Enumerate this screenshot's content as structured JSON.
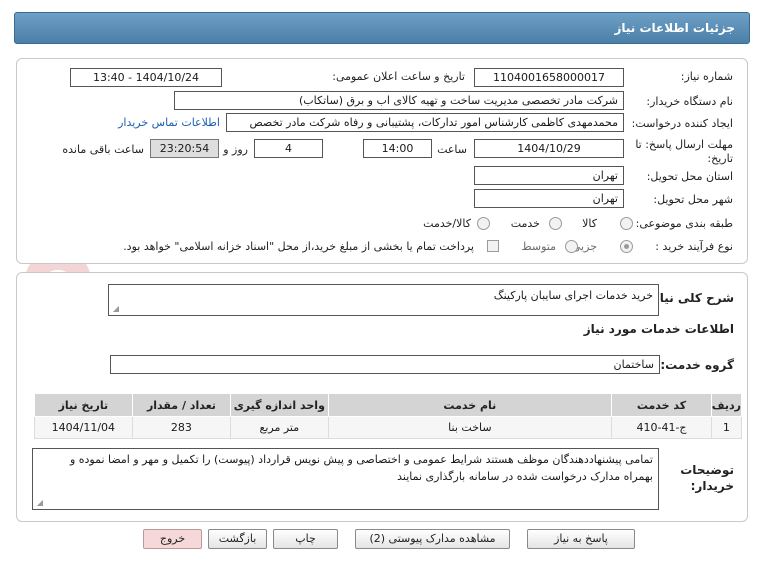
{
  "header": {
    "title": "جزئیات اطلاعات نیاز"
  },
  "need_number": {
    "label": "شماره نیاز:",
    "value": "1104001658000017"
  },
  "announce_date": {
    "label": "تاریخ و ساعت اعلان عمومی:",
    "value": "1404/10/24 - 13:40"
  },
  "buyer_org": {
    "label": "نام دستگاه خریدار:",
    "value": "شرکت مادر تخصصی مدیریت ساخت و تهیه کالای اب و برق (ساتکاب)"
  },
  "requester": {
    "label": "ایجاد کننده درخواست:",
    "value": "محمدمهدی کاظمی کارشناس امور تدارکات، پشتیبانی و رفاه شرکت مادر تخصص",
    "contact_link": "اطلاعات تماس خریدار"
  },
  "deadline": {
    "label_line1": "مهلت ارسال پاسخ: تا",
    "label_line2": "تاریخ:",
    "date": "1404/10/29",
    "time_label": "ساعت",
    "time": "14:00",
    "days": "4",
    "days_label": "روز و",
    "remaining": "23:20:54",
    "remaining_label": "ساعت باقی مانده"
  },
  "delivery_province": {
    "label": "استان محل تحویل:",
    "value": "تهران"
  },
  "delivery_city": {
    "label": "شهر محل تحویل:",
    "value": "تهران"
  },
  "category": {
    "label": "طبقه بندی موضوعی:",
    "options": [
      "کالا",
      "خدمت",
      "کالا/خدمت"
    ],
    "selected": "خدمت"
  },
  "process_type": {
    "label": "نوع فرآیند خرید :",
    "options": [
      "جزیی",
      "متوسط"
    ],
    "selected": "جزیی",
    "treasury_check_label": "پرداخت تمام یا بخشی از مبلغ خرید،از محل \"اسناد خزانه اسلامی\" خواهد بود."
  },
  "general_description": {
    "label": "شرح کلی نیاز:",
    "value": "خرید خدمات اجرای سایبان پارکینگ"
  },
  "services_info": {
    "heading": "اطلاعات خدمات مورد نیاز"
  },
  "service_group": {
    "label": "گروه خدمت:",
    "value": "ساختمان"
  },
  "items_table": {
    "headers": [
      "ردیف",
      "کد خدمت",
      "نام خدمت",
      "واحد اندازه گیری",
      "تعداد / مقدار",
      "تاریخ نیاز"
    ],
    "rows": [
      [
        "1",
        "ج-41-410",
        "ساخت بنا",
        "متر مربع",
        "283",
        "1404/11/04"
      ]
    ]
  },
  "buyer_notes": {
    "label_line1": "توضیحات",
    "label_line2": "خریدار:",
    "value": "تمامی پیشنهاددهندگان موظف هستند شرایط عمومی و اختصاصی و پیش نویس قرارداد (پیوست) را تکمیل و مهر و امضا نموده و بهمراه مدارک درخواست شده در سامانه بارگذاری نمایند"
  },
  "buttons": {
    "reply": "پاسخ به نیاز",
    "attachments": "مشاهده مدارک پیوستی (2)",
    "print": "چاپ",
    "back": "بازگشت",
    "exit": "خروج"
  },
  "watermark": {
    "text": "AriaTender.neT"
  },
  "colors": {
    "header": "#4a7fa8",
    "link": "#1a5fb4",
    "exit_button": "#f6d8d8"
  }
}
